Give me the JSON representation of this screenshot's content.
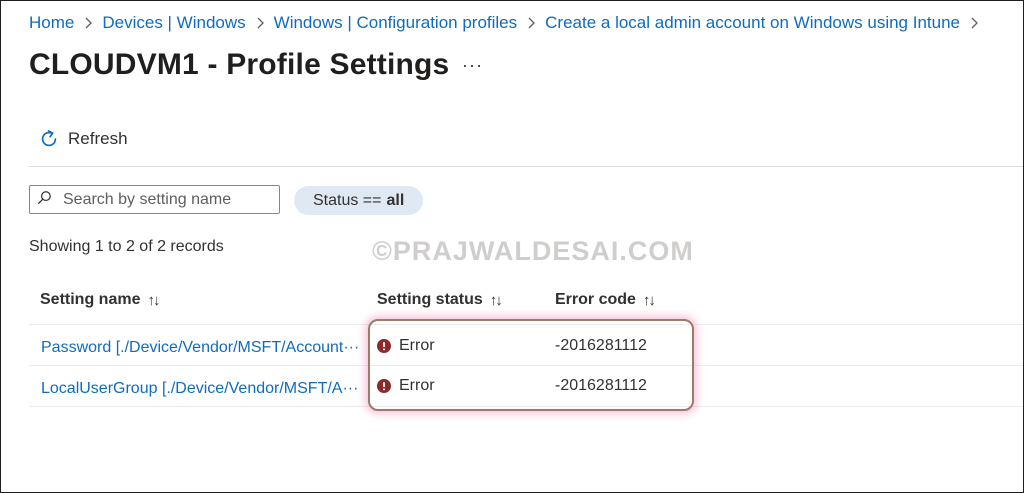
{
  "breadcrumb": [
    {
      "label": "Home"
    },
    {
      "label": "Devices | Windows"
    },
    {
      "label": "Windows | Configuration profiles"
    },
    {
      "label": "Create a local admin account on Windows using Intune"
    }
  ],
  "page": {
    "title": "CLOUDVM1 - Profile Settings",
    "more": "···"
  },
  "toolbar": {
    "refresh_label": "Refresh"
  },
  "search": {
    "placeholder": "Search by setting name",
    "value": ""
  },
  "filter": {
    "status_label": "Status ==",
    "status_value": "all"
  },
  "records": "Showing 1 to 2 of 2 records",
  "watermark": "©PRAJWALDESAI.COM",
  "table": {
    "columns": [
      {
        "label": "Setting name",
        "sort": "↑↓"
      },
      {
        "label": "Setting status",
        "sort": "↑↓"
      },
      {
        "label": "Error code",
        "sort": "↑↓"
      }
    ],
    "rows": [
      {
        "name": "Password [./Device/Vendor/MSFT/Account···",
        "status": "Error",
        "code": "-2016281112"
      },
      {
        "name": "LocalUserGroup [./Device/Vendor/MSFT/A···",
        "status": "Error",
        "code": "-2016281112"
      }
    ]
  },
  "colors": {
    "link": "#0f6cbd",
    "error": "#a4262c",
    "pill": "#dfe9f4",
    "highlight_border": "#9c7a6c"
  }
}
